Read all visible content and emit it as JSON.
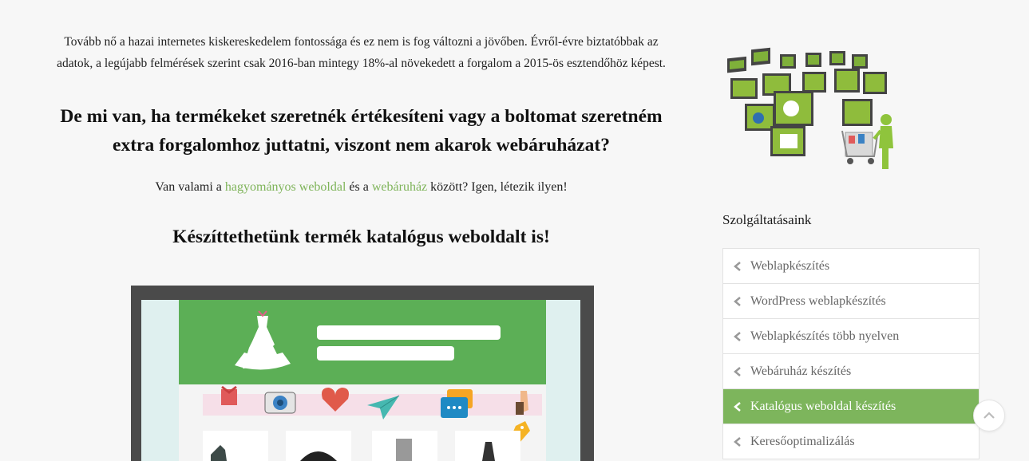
{
  "content": {
    "intro": "Tovább nő a hazai internetes kiskereskedelem fontossága és ez nem is fog változni a jövőben. Évről-évre biztatóbbak az adatok, a legújabb felmérések szerint csak 2016-ban mintegy 18%-al növekedett a forgalom a 2015-ös esztendőhöz képest.",
    "heading1": "De mi van, ha termékeket szeretnék értékesíteni vagy a boltomat szeretném extra forgalomhoz juttatni, viszont nem akarok webáruházat?",
    "para_prefix": "Van valami a ",
    "link1": "hagyományos weboldal",
    "para_middle": " és a ",
    "link2": "webáruház",
    "para_suffix": " között? Igen, létezik ilyen!",
    "heading2": "Készíttethetünk termék katalógus weboldalt is!"
  },
  "sidebar": {
    "services_title": "Szolgáltatásaink",
    "services": [
      {
        "label": "Weblapkészítés"
      },
      {
        "label": "WordPress weblapkészítés"
      },
      {
        "label": "Weblapkészítés több nyelven"
      },
      {
        "label": "Webáruház készítés"
      },
      {
        "label": "Katalógus weboldal készítés",
        "active": true
      },
      {
        "label": "Keresőoptimalizálás"
      }
    ]
  },
  "colors": {
    "accent": "#7db55c",
    "link": "#7fb45a",
    "text": "#222222"
  },
  "icons": {
    "list_chevron": "chevron-left-icon",
    "scroll_top": "chevron-up-icon"
  }
}
